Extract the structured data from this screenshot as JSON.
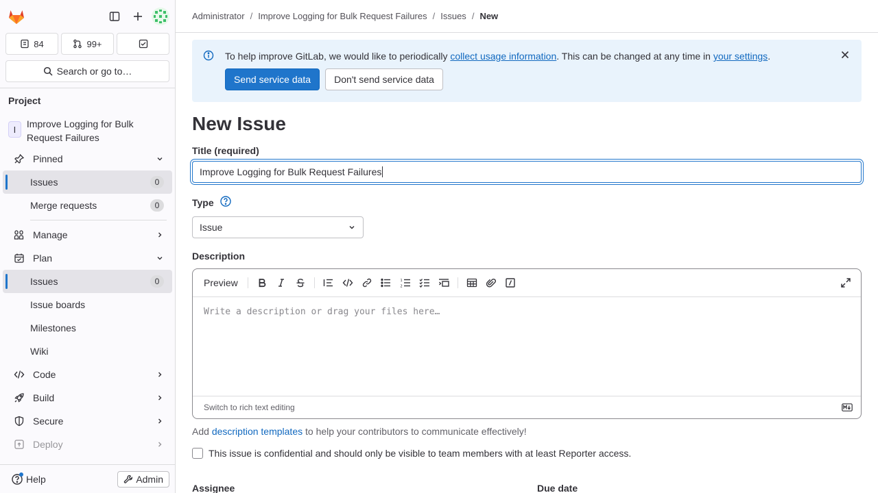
{
  "sidebar": {
    "counts": {
      "issues": "84",
      "merge_requests": "99+"
    },
    "search_label": "Search or go to…",
    "section_title": "Project",
    "project": {
      "initial": "I",
      "name": "Improve Logging for Bulk Request Failures"
    },
    "pinned": {
      "label": "Pinned",
      "items": [
        {
          "label": "Issues",
          "count": "0"
        },
        {
          "label": "Merge requests",
          "count": "0"
        }
      ]
    },
    "groups": [
      {
        "label": "Manage"
      },
      {
        "label": "Plan"
      },
      {
        "label": "Code"
      },
      {
        "label": "Build"
      },
      {
        "label": "Secure"
      },
      {
        "label": "Deploy"
      }
    ],
    "plan_items": [
      {
        "label": "Issues",
        "count": "0"
      },
      {
        "label": "Issue boards"
      },
      {
        "label": "Milestones"
      },
      {
        "label": "Wiki"
      }
    ],
    "help_label": "Help",
    "admin_label": "Admin"
  },
  "breadcrumb": [
    "Administrator",
    "Improve Logging for Bulk Request Failures",
    "Issues",
    "New"
  ],
  "alert": {
    "text_before": "To help improve GitLab, we would like to periodically ",
    "link1": "collect usage information",
    "text_middle": ". This can be changed at any time in ",
    "link2": "your settings",
    "text_after": ".",
    "primary_button": "Send service data",
    "secondary_button": "Don't send service data"
  },
  "page_title": "New Issue",
  "form": {
    "title_label": "Title (required)",
    "title_value": "Improve Logging for Bulk Request Failures",
    "type_label": "Type",
    "type_value": "Issue",
    "description_label": "Description",
    "preview_label": "Preview",
    "description_placeholder": "Write a description or drag your files here…",
    "switch_label": "Switch to rich text editing",
    "templates_before": "Add ",
    "templates_link": "description templates",
    "templates_after": " to help your contributors to communicate effectively!",
    "confidential_label": "This issue is confidential and should only be visible to team members with at least Reporter access.",
    "assignee_label": "Assignee",
    "due_date_label": "Due date"
  },
  "colors": {
    "accent": "#1f75cb",
    "alert_bg": "#e9f3fc",
    "logo": "#e24329"
  }
}
